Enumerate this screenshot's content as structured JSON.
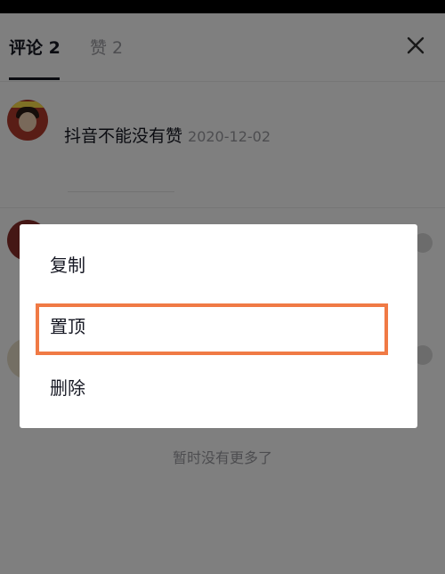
{
  "tabs": {
    "comments": "评论 2",
    "likes": "赞 2"
  },
  "icons": {
    "close": "close-icon"
  },
  "comment": {
    "text": "抖音不能没有赞",
    "date": "2020-12-02"
  },
  "footer": {
    "no_more": "暂时没有更多了"
  },
  "context_menu": {
    "copy": "复制",
    "pin": "置顶",
    "delete": "删除"
  },
  "colors": {
    "highlight": "#f07a45",
    "text": "#161823",
    "muted": "#9a9ba0"
  }
}
